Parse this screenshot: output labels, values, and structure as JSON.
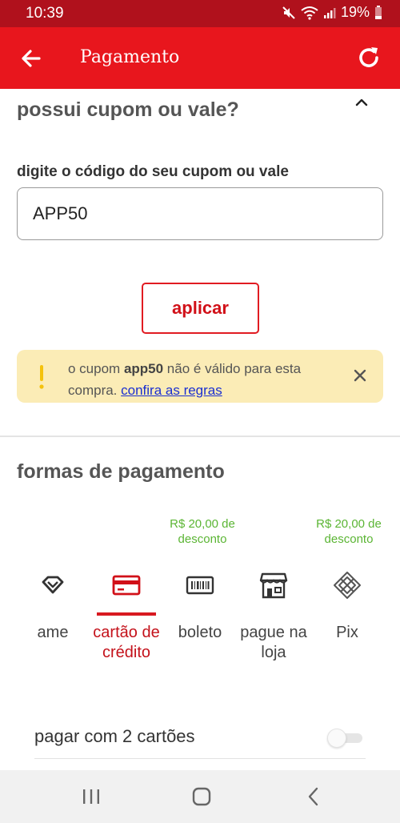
{
  "status_bar": {
    "time": "10:39",
    "battery": "19%",
    "icons": [
      "mute-icon",
      "wifi-icon",
      "signal-icon",
      "battery-icon"
    ]
  },
  "app_bar": {
    "title": "Pagamento",
    "back_icon": "arrow-left-icon",
    "refresh_icon": "refresh-icon"
  },
  "coupon": {
    "title": "possui cupom ou vale?",
    "field_label": "digite o código do seu cupom ou vale",
    "value": "APP50",
    "apply_label": "aplicar"
  },
  "alert": {
    "text_before": "o cupom ",
    "code": "app50",
    "text_after": " não é válido para esta compra. ",
    "link": "confira as regras",
    "icon": "exclamation-icon"
  },
  "payment": {
    "title": "formas de pagamento",
    "discount_boleto": "R$ 20,00 de desconto",
    "discount_pix": "R$ 20,00 de desconto",
    "methods": [
      {
        "label": "ame",
        "icon": "ame-icon",
        "active": false
      },
      {
        "label": "cartão de crédito",
        "icon": "credit-card-icon",
        "active": true
      },
      {
        "label": "boleto",
        "icon": "barcode-icon",
        "active": false
      },
      {
        "label": "pague na loja",
        "icon": "store-icon",
        "active": false
      },
      {
        "label": "Pix",
        "icon": "pix-icon",
        "active": false
      }
    ],
    "two_cards_label": "pagar com 2 cartões",
    "two_cards_enabled": false
  },
  "colors": {
    "primary": "#e8161d",
    "status_bar": "#b0111c",
    "discount": "#5bb534",
    "alert_bg": "#fbecb6",
    "link": "#1a2fd1"
  }
}
